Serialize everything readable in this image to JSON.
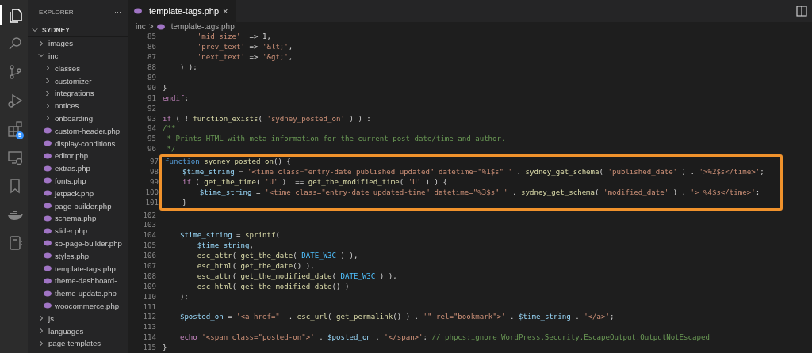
{
  "activity_bar": [
    {
      "kind": "files",
      "selected": true
    },
    {
      "kind": "search",
      "selected": false
    },
    {
      "kind": "source-control",
      "selected": false
    },
    {
      "kind": "run",
      "selected": false
    },
    {
      "kind": "extensions",
      "selected": false,
      "badge": "5"
    },
    {
      "kind": "remote",
      "selected": false
    },
    {
      "kind": "bookmark",
      "selected": false
    },
    {
      "kind": "docker",
      "selected": false
    },
    {
      "kind": "notebook",
      "selected": false
    }
  ],
  "sidebar": {
    "title": "EXPLORER",
    "more": "···",
    "root": {
      "label": "SYDNEY",
      "expanded": true
    },
    "items": [
      {
        "kind": "folder",
        "label": "images",
        "expanded": false
      },
      {
        "kind": "folder",
        "label": "inc",
        "expanded": true,
        "children": [
          {
            "kind": "folder",
            "label": "classes",
            "expanded": false
          },
          {
            "kind": "folder",
            "label": "customizer",
            "expanded": false
          },
          {
            "kind": "folder",
            "label": "integrations",
            "expanded": false
          },
          {
            "kind": "folder",
            "label": "notices",
            "expanded": false
          },
          {
            "kind": "folder",
            "label": "onboarding",
            "expanded": false
          },
          {
            "kind": "file",
            "label": "custom-header.php"
          },
          {
            "kind": "file",
            "label": "display-conditions...."
          },
          {
            "kind": "file",
            "label": "editor.php"
          },
          {
            "kind": "file",
            "label": "extras.php"
          },
          {
            "kind": "file",
            "label": "fonts.php"
          },
          {
            "kind": "file",
            "label": "jetpack.php"
          },
          {
            "kind": "file",
            "label": "page-builder.php"
          },
          {
            "kind": "file",
            "label": "schema.php"
          },
          {
            "kind": "file",
            "label": "slider.php"
          },
          {
            "kind": "file",
            "label": "so-page-builder.php"
          },
          {
            "kind": "file",
            "label": "styles.php"
          },
          {
            "kind": "file",
            "label": "template-tags.php"
          },
          {
            "kind": "file",
            "label": "theme-dashboard-..."
          },
          {
            "kind": "file",
            "label": "theme-update.php"
          },
          {
            "kind": "file",
            "label": "woocommerce.php"
          }
        ]
      },
      {
        "kind": "folder",
        "label": "js",
        "expanded": false
      },
      {
        "kind": "folder",
        "label": "languages",
        "expanded": false
      },
      {
        "kind": "folder",
        "label": "page-templates",
        "expanded": false
      }
    ]
  },
  "tabs": [
    {
      "label": "template-tags.php",
      "close": "×",
      "selected": true
    }
  ],
  "breadcrumb": {
    "folder": "inc",
    "separator": ">",
    "file": "template-tags.php"
  },
  "code": [
    {
      "number": "85",
      "text": "        'mid_size'  => 1,",
      "highlighted": false
    },
    {
      "number": "86",
      "text": "        'prev_text' => '&lt;',",
      "highlighted": false
    },
    {
      "number": "87",
      "text": "        'next_text' => '&gt;',",
      "highlighted": false
    },
    {
      "number": "88",
      "text": "    ) );",
      "highlighted": false
    },
    {
      "number": "89",
      "highlighted": false
    },
    {
      "number": "90",
      "text": "}",
      "highlighted": false
    },
    {
      "number": "91",
      "text": "endif;",
      "highlighted": false
    },
    {
      "number": "92",
      "highlighted": false
    },
    {
      "number": "93",
      "text": "if ( ! function_exists( 'sydney_posted_on' ) ) :",
      "highlighted": false
    },
    {
      "number": "94",
      "text": "/**",
      "highlighted": false
    },
    {
      "number": "95",
      "text": " * Prints HTML with meta information for the current post-date/time and author.",
      "highlighted": false
    },
    {
      "number": "96",
      "text": " */",
      "highlighted": false
    },
    {
      "number": "97",
      "text": "function sydney_posted_on() {",
      "highlighted": true
    },
    {
      "number": "98",
      "text": "    $time_string = '<time class=\"entry-date published updated\" datetime=\"%1$s\" ' . sydney_get_schema( 'published_date' ) . '>%2$s</time>';",
      "highlighted": true
    },
    {
      "number": "99",
      "text": "    if ( get_the_time( 'U' ) !== get_the_modified_time( 'U' ) ) {",
      "highlighted": true
    },
    {
      "number": "100",
      "text": "        $time_string = '<time class=\"entry-date updated-time\" datetime=\"%3$s\" ' . sydney_get_schema( 'modified_date' ) . '> %4$s</time>';",
      "highlighted": true
    },
    {
      "number": "101",
      "text": "    }",
      "highlighted": true
    },
    {
      "number": "102",
      "highlighted": false
    },
    {
      "number": "103",
      "highlighted": false
    },
    {
      "number": "104",
      "text": "    $time_string = sprintf(",
      "highlighted": false
    },
    {
      "number": "105",
      "text": "        $time_string,",
      "highlighted": false
    },
    {
      "number": "106",
      "text": "        esc_attr( get_the_date( DATE_W3C ) ),",
      "highlighted": false
    },
    {
      "number": "107",
      "text": "        esc_html( get_the_date() ),",
      "highlighted": false
    },
    {
      "number": "108",
      "text": "        esc_attr( get_the_modified_date( DATE_W3C ) ),",
      "highlighted": false
    },
    {
      "number": "109",
      "text": "        esc_html( get_the_modified_date() )",
      "highlighted": false
    },
    {
      "number": "110",
      "text": "    );",
      "highlighted": false
    },
    {
      "number": "111",
      "highlighted": false
    },
    {
      "number": "112",
      "text": "    $posted_on = '<a href=\"' . esc_url( get_permalink() ) . '\" rel=\"bookmark\">' . $time_string . '</a>';",
      "highlighted": false
    },
    {
      "number": "113",
      "highlighted": false
    },
    {
      "number": "114",
      "text": "    echo '<span class=\"posted-on\">' . $posted_on . '</span>'; // phpcs:ignore WordPress.Security.EscapeOutput.OutputNotEscaped",
      "highlighted": false
    },
    {
      "number": "115",
      "text": "}",
      "highlighted": false
    }
  ]
}
